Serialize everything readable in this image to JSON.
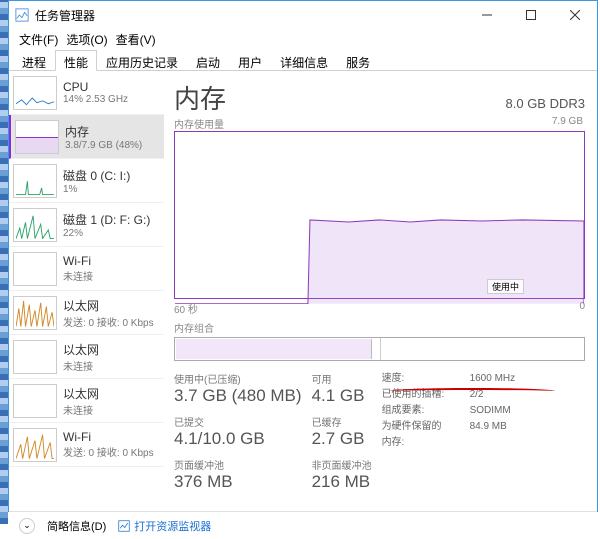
{
  "window": {
    "title": "任务管理器"
  },
  "menu": {
    "file": "文件(F)",
    "options": "选项(O)",
    "view": "查看(V)"
  },
  "tabs": [
    "进程",
    "性能",
    "应用历史记录",
    "启动",
    "用户",
    "详细信息",
    "服务"
  ],
  "sidebar": {
    "items": [
      {
        "name": "CPU",
        "sub": "14% 2.53 GHz",
        "color": "#2e7fcf"
      },
      {
        "name": "内存",
        "sub": "3.8/7.9 GB (48%)",
        "color": "#8a3abf"
      },
      {
        "name": "磁盘 0 (C: I:)",
        "sub": "1%",
        "color": "#2fa36a"
      },
      {
        "name": "磁盘 1 (D: F: G:)",
        "sub": "22%",
        "color": "#2fa36a"
      },
      {
        "name": "Wi-Fi",
        "sub": "未连接",
        "color": "#d28a2a"
      },
      {
        "name": "以太网",
        "sub": "发送: 0 接收: 0 Kbps",
        "color": "#d28a2a"
      },
      {
        "name": "以太网",
        "sub": "未连接",
        "color": "#d28a2a"
      },
      {
        "name": "以太网",
        "sub": "未连接",
        "color": "#d28a2a"
      },
      {
        "name": "Wi-Fi",
        "sub": "发送: 0 接收: 0 Kbps",
        "color": "#d28a2a"
      }
    ]
  },
  "main": {
    "title": "内存",
    "spec": "8.0 GB DDR3",
    "usage_label": "内存使用量",
    "usage_max": "7.9 GB",
    "x_start": "60 秒",
    "x_end": "0",
    "in_use_label": "使用中",
    "composition_label": "内存组合",
    "stats": {
      "in_use": {
        "label": "使用中(已压缩)",
        "value": "3.7 GB (480 MB)"
      },
      "available": {
        "label": "可用",
        "value": "4.1 GB"
      },
      "committed": {
        "label": "已提交",
        "value": "4.1/10.0 GB"
      },
      "cached": {
        "label": "已缓存",
        "value": "2.7 GB"
      },
      "paged": {
        "label": "页面缓冲池",
        "value": "376 MB"
      },
      "nonpaged": {
        "label": "非页面缓冲池",
        "value": "216 MB"
      }
    },
    "kv": {
      "speed": {
        "k": "速度:",
        "v": "1600 MHz"
      },
      "slots": {
        "k": "已使用的插槽:",
        "v": "2/2"
      },
      "form": {
        "k": "组成要素:",
        "v": "SODIMM"
      },
      "reserved": {
        "k": "为硬件保留的内存:",
        "v": "84.9 MB"
      }
    }
  },
  "chart_data": {
    "type": "area",
    "title": "内存使用量",
    "ylabel": "GB",
    "ylim": [
      0,
      7.9
    ],
    "x_range_seconds": [
      60,
      0
    ],
    "series": [
      {
        "name": "使用中",
        "values": [
          0,
          0,
          0,
          0,
          0,
          0,
          0,
          0,
          0,
          0,
          0,
          0,
          0,
          0,
          0,
          0,
          0,
          0,
          0,
          0,
          3.8,
          3.8,
          3.8,
          3.8,
          3.8,
          3.8,
          3.8,
          3.8,
          3.8,
          3.8,
          3.8,
          3.8,
          3.8,
          3.8,
          3.8,
          3.8,
          3.8,
          3.8,
          3.8,
          3.8,
          3.8,
          3.8,
          3.8,
          3.8,
          3.8,
          3.8,
          3.8,
          3.8,
          3.8,
          3.8,
          3.8,
          3.8,
          3.8,
          3.8,
          3.8,
          3.8,
          3.8,
          3.8,
          3.8,
          3.8
        ]
      }
    ]
  },
  "footer": {
    "fewer": "简略信息(D)",
    "resmon": "打开资源监视器"
  }
}
